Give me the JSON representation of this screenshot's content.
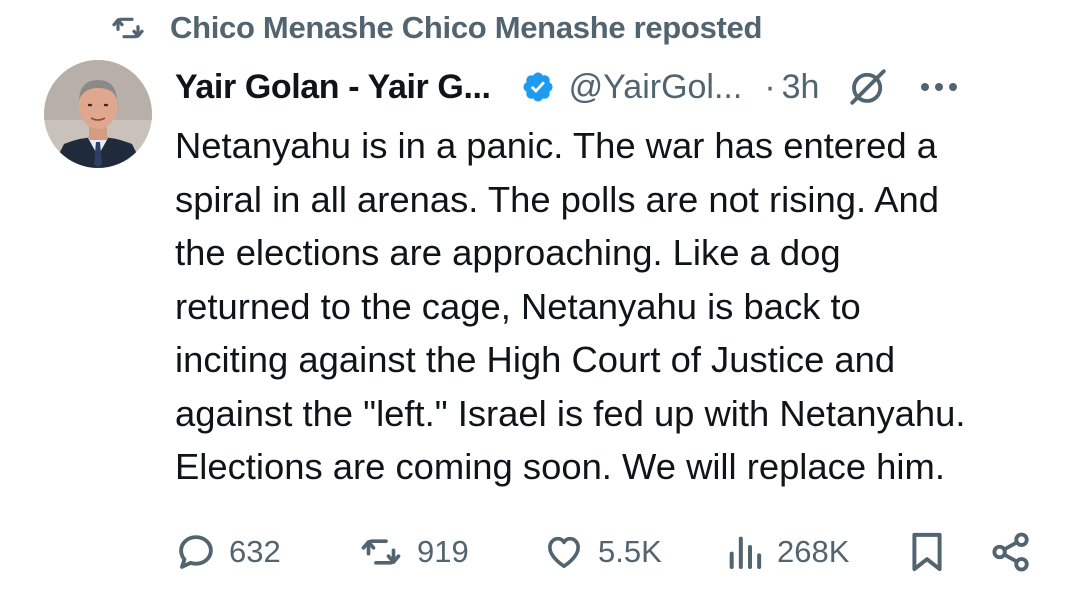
{
  "repost": {
    "icon": "repost-icon",
    "text": "Chico Menashe Chico Menashe reposted"
  },
  "tweet": {
    "avatar": "profile-photo",
    "display_name": "Yair Golan - Yair G...",
    "verified_icon": "verified-badge-icon",
    "handle": "@YairGol...",
    "separator": "·",
    "time": "3h",
    "grok_icon": "grok-icon",
    "more_icon": "more-options-icon",
    "lines": [
      "Netanyahu is in a panic. The war has entered a",
      "spiral in all arenas. The polls are not rising. And",
      "the elections are approaching. Like a dog",
      "returned to the cage, Netanyahu is back to",
      "inciting against the High Court of Justice and",
      "against the \"left.\" Israel is fed up with Netanyahu.",
      "Elections are coming soon. We will replace him."
    ]
  },
  "actions": {
    "reply_count": "632",
    "repost_count": "919",
    "like_count": "5.5K",
    "views_count": "268K",
    "bookmark_icon": "bookmark-icon",
    "share_icon": "share-icon"
  },
  "colors": {
    "text": "#0f1419",
    "secondary": "#536471",
    "verified": "#1d9bf0"
  }
}
